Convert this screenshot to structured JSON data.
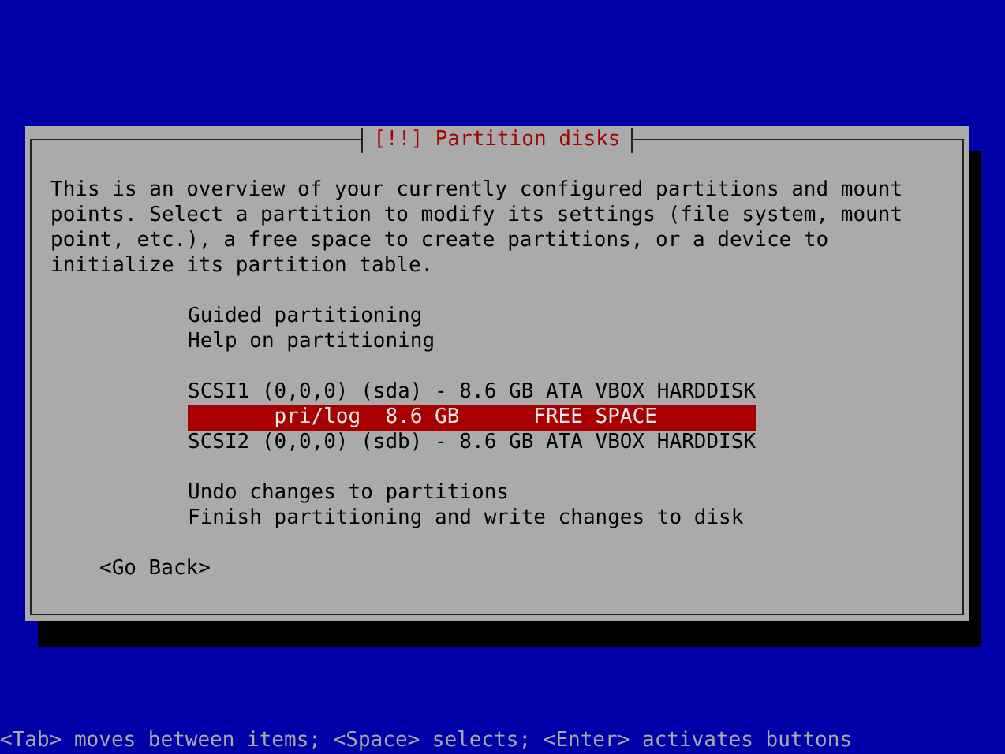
{
  "dialog": {
    "title": "[!!] Partition disks",
    "description": "This is an overview of your currently configured partitions and mount points. Select a partition to modify its settings (file system, mount point, etc.), a free space to create partitions, or a device to initialize its partition table.",
    "menu_groups": [
      {
        "items": [
          {
            "kind": "action",
            "text": "Guided partitioning",
            "selected": false
          },
          {
            "kind": "action",
            "text": "Help on partitioning",
            "selected": false
          }
        ]
      },
      {
        "items": [
          {
            "kind": "disk",
            "text": "SCSI1 (0,0,0) (sda) - 8.6 GB ATA VBOX HARDDISK",
            "selected": false
          },
          {
            "kind": "partition",
            "text": "pri/log  8.6 GB      FREE SPACE",
            "selected": true
          },
          {
            "kind": "disk",
            "text": "SCSI2 (0,0,0) (sdb) - 8.6 GB ATA VBOX HARDDISK",
            "selected": false
          }
        ]
      },
      {
        "items": [
          {
            "kind": "action",
            "text": "Undo changes to partitions",
            "selected": false
          },
          {
            "kind": "action",
            "text": "Finish partitioning and write changes to disk",
            "selected": false
          }
        ]
      }
    ],
    "back_button": "<Go Back>"
  },
  "status_bar": "<Tab> moves between items; <Space> selects; <Enter> activates buttons"
}
